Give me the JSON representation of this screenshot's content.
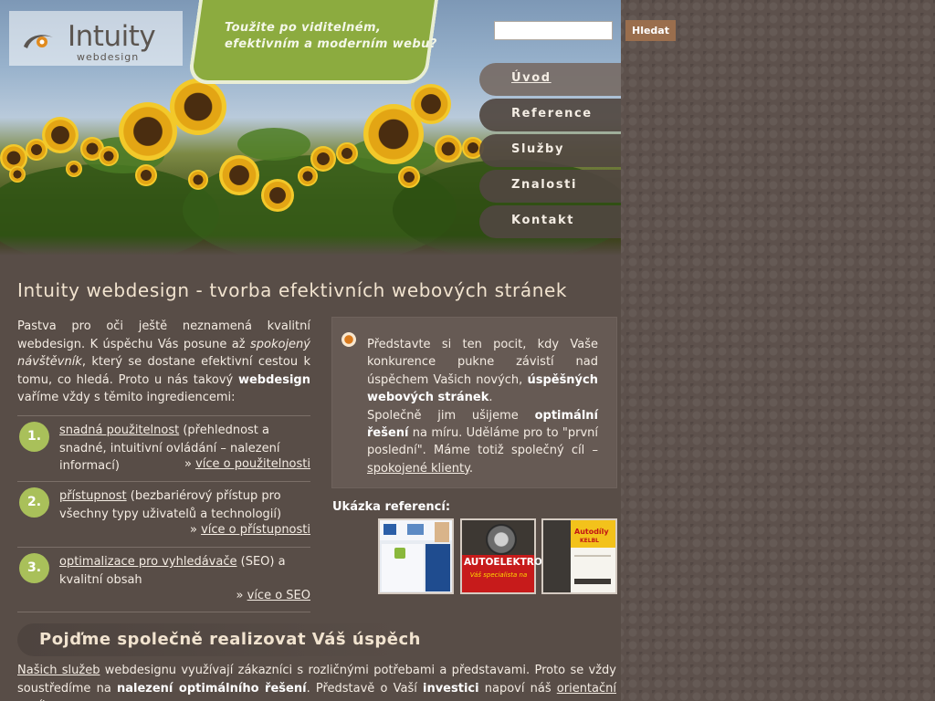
{
  "brand": {
    "logo_name": "Intuity",
    "logo_sub": "webdesign",
    "tagline_line1": "Toužite po viditelném,",
    "tagline_line2": "efektivním a moderním webu?",
    "colors": {
      "accent_green": "#8cab3f",
      "accent_orange": "#d97a1e",
      "background": "#5d514c"
    }
  },
  "search": {
    "placeholder": "",
    "value": "",
    "button_label": "Hledat"
  },
  "nav": {
    "items": [
      {
        "label": "Úvod",
        "active": true
      },
      {
        "label": "Reference",
        "active": false
      },
      {
        "label": "Služby",
        "active": false
      },
      {
        "label": "Znalosti",
        "active": false
      },
      {
        "label": "Kontakt",
        "active": false
      }
    ]
  },
  "main": {
    "title": "Intuity webdesign - tvorba efektivních webových stránek",
    "intro": {
      "p1": "Pastva pro oči ještě neznamená kvalitní webdesign. K úspěchu Vás posune až ",
      "em": "spokojený návštěvník",
      "p2": ", který se dostane efektivní cestou k tomu, co hledá. Proto u nás takový ",
      "strong": "webdesign",
      "p3": " vaříme vždy s těmito ingrediencemi:"
    },
    "features": [
      {
        "number": "1.",
        "link": "snadná použitelnost",
        "text": " (přehlednost a snadné, intuitivní ovládání – nalezení informací)",
        "more": "více o použitelnosti"
      },
      {
        "number": "2.",
        "link": "přístupnost",
        "text": " (bezbariérový přístup pro všechny typy uživatelů a technologií)",
        "more": "více o přístupnosti"
      },
      {
        "number": "3.",
        "link": "optimalizace pro vyhledávače",
        "text": " (SEO) a kvalitní obsah",
        "more": "více o SEO"
      }
    ],
    "more_prefix": "» "
  },
  "box": {
    "t1": "Představte si ten pocit, kdy Vaše konkurence pukne závistí nad úspěchem Vašich nových, ",
    "s1": "úspěšných webových stránek",
    "t2": ".",
    "t3": "Společně jim ušijeme ",
    "s2": "optimální řešení",
    "t4": " na míru. Uděláme pro to \"první poslední\". Máme totiž společný cíl – ",
    "link": "spokojené klienty",
    "t5": "."
  },
  "references": {
    "title": "Ukázka referencí:",
    "thumbs": [
      {
        "caption": ""
      },
      {
        "caption": "AUTOELEKTRO",
        "subcaption": "Váš specialista na"
      },
      {
        "caption": "Autodíly",
        "subcaption": "KELBL"
      }
    ]
  },
  "section2": {
    "title": "Pojďme společně realizovat Váš úspěch",
    "link1": "Našich služeb",
    "t1": " webdesignu využívají zákazníci s rozličnými potřebami a představami. Proto se vždy soustředíme na ",
    "s1": "nalezení optimálního řešení",
    "t2": ". Představě o Vaší ",
    "s2": "investici",
    "t3": " napoví náš ",
    "link2": "orientační ceník",
    "t4": "."
  }
}
